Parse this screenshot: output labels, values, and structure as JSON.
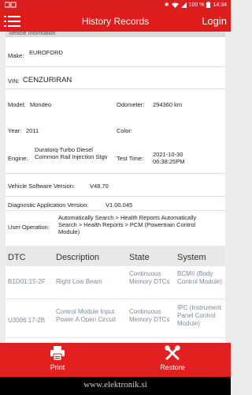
{
  "status_bar": {
    "battery": "100 %",
    "time": "14:34"
  },
  "app_bar": {
    "title": "History Records",
    "login": "Login"
  },
  "details": {
    "section_header": "Vehicle Information",
    "make": {
      "label": "Make:",
      "value": "EUROFORD"
    },
    "vin": {
      "label": "VIN:",
      "value": "CENZURIRAN"
    },
    "model": {
      "label": "Model:",
      "value": "Mondeo"
    },
    "odometer": {
      "label": "Odometer:",
      "value": "294360 km"
    },
    "year": {
      "label": "Year:",
      "value": "2011"
    },
    "color": {
      "label": "Color:",
      "value": ""
    },
    "engine": {
      "label": "Engine:",
      "value": "Duratorq-Turbo Diesel Common Rail Injection Stgv"
    },
    "test_time": {
      "label": "Test Time:",
      "value": "2021-10-30 06:38:25PM"
    },
    "vehicle_software": {
      "label": "Vehicle Software Version:",
      "value": "V48.70"
    },
    "diagnostic_app": {
      "label": "Diagnostic Application Version:",
      "value": "V1.00.045"
    },
    "user_operation": {
      "label": "User Operation:",
      "value": "Automatically Search > Health Reports Automatically Search > Health Reports > PCM (Powertrain Control Module)"
    }
  },
  "dtc_table": {
    "headers": {
      "dtc": "DTC",
      "description": "Description",
      "state": "State",
      "system": "System"
    },
    "rows": [
      {
        "dtc": "B1D01:15-2F",
        "description": "Right Low Beam",
        "state": "Continuous Memory DTCs",
        "system": "BCMII (Body Control Module)"
      },
      {
        "dtc": "U3006:17-2B",
        "description": "Control Module Input Power A Open Circuit",
        "state": "Continuous Memory DTCs",
        "system": "IPC (Instrument Panel Control Module)"
      }
    ]
  },
  "toolbar": {
    "print": "Print",
    "restore": "Restore"
  },
  "nav_bar": {
    "watermark": "www.elektronik.si"
  },
  "colors": {
    "brand_red": "#e01b1b",
    "dtc_text": "#7b8aa8"
  }
}
